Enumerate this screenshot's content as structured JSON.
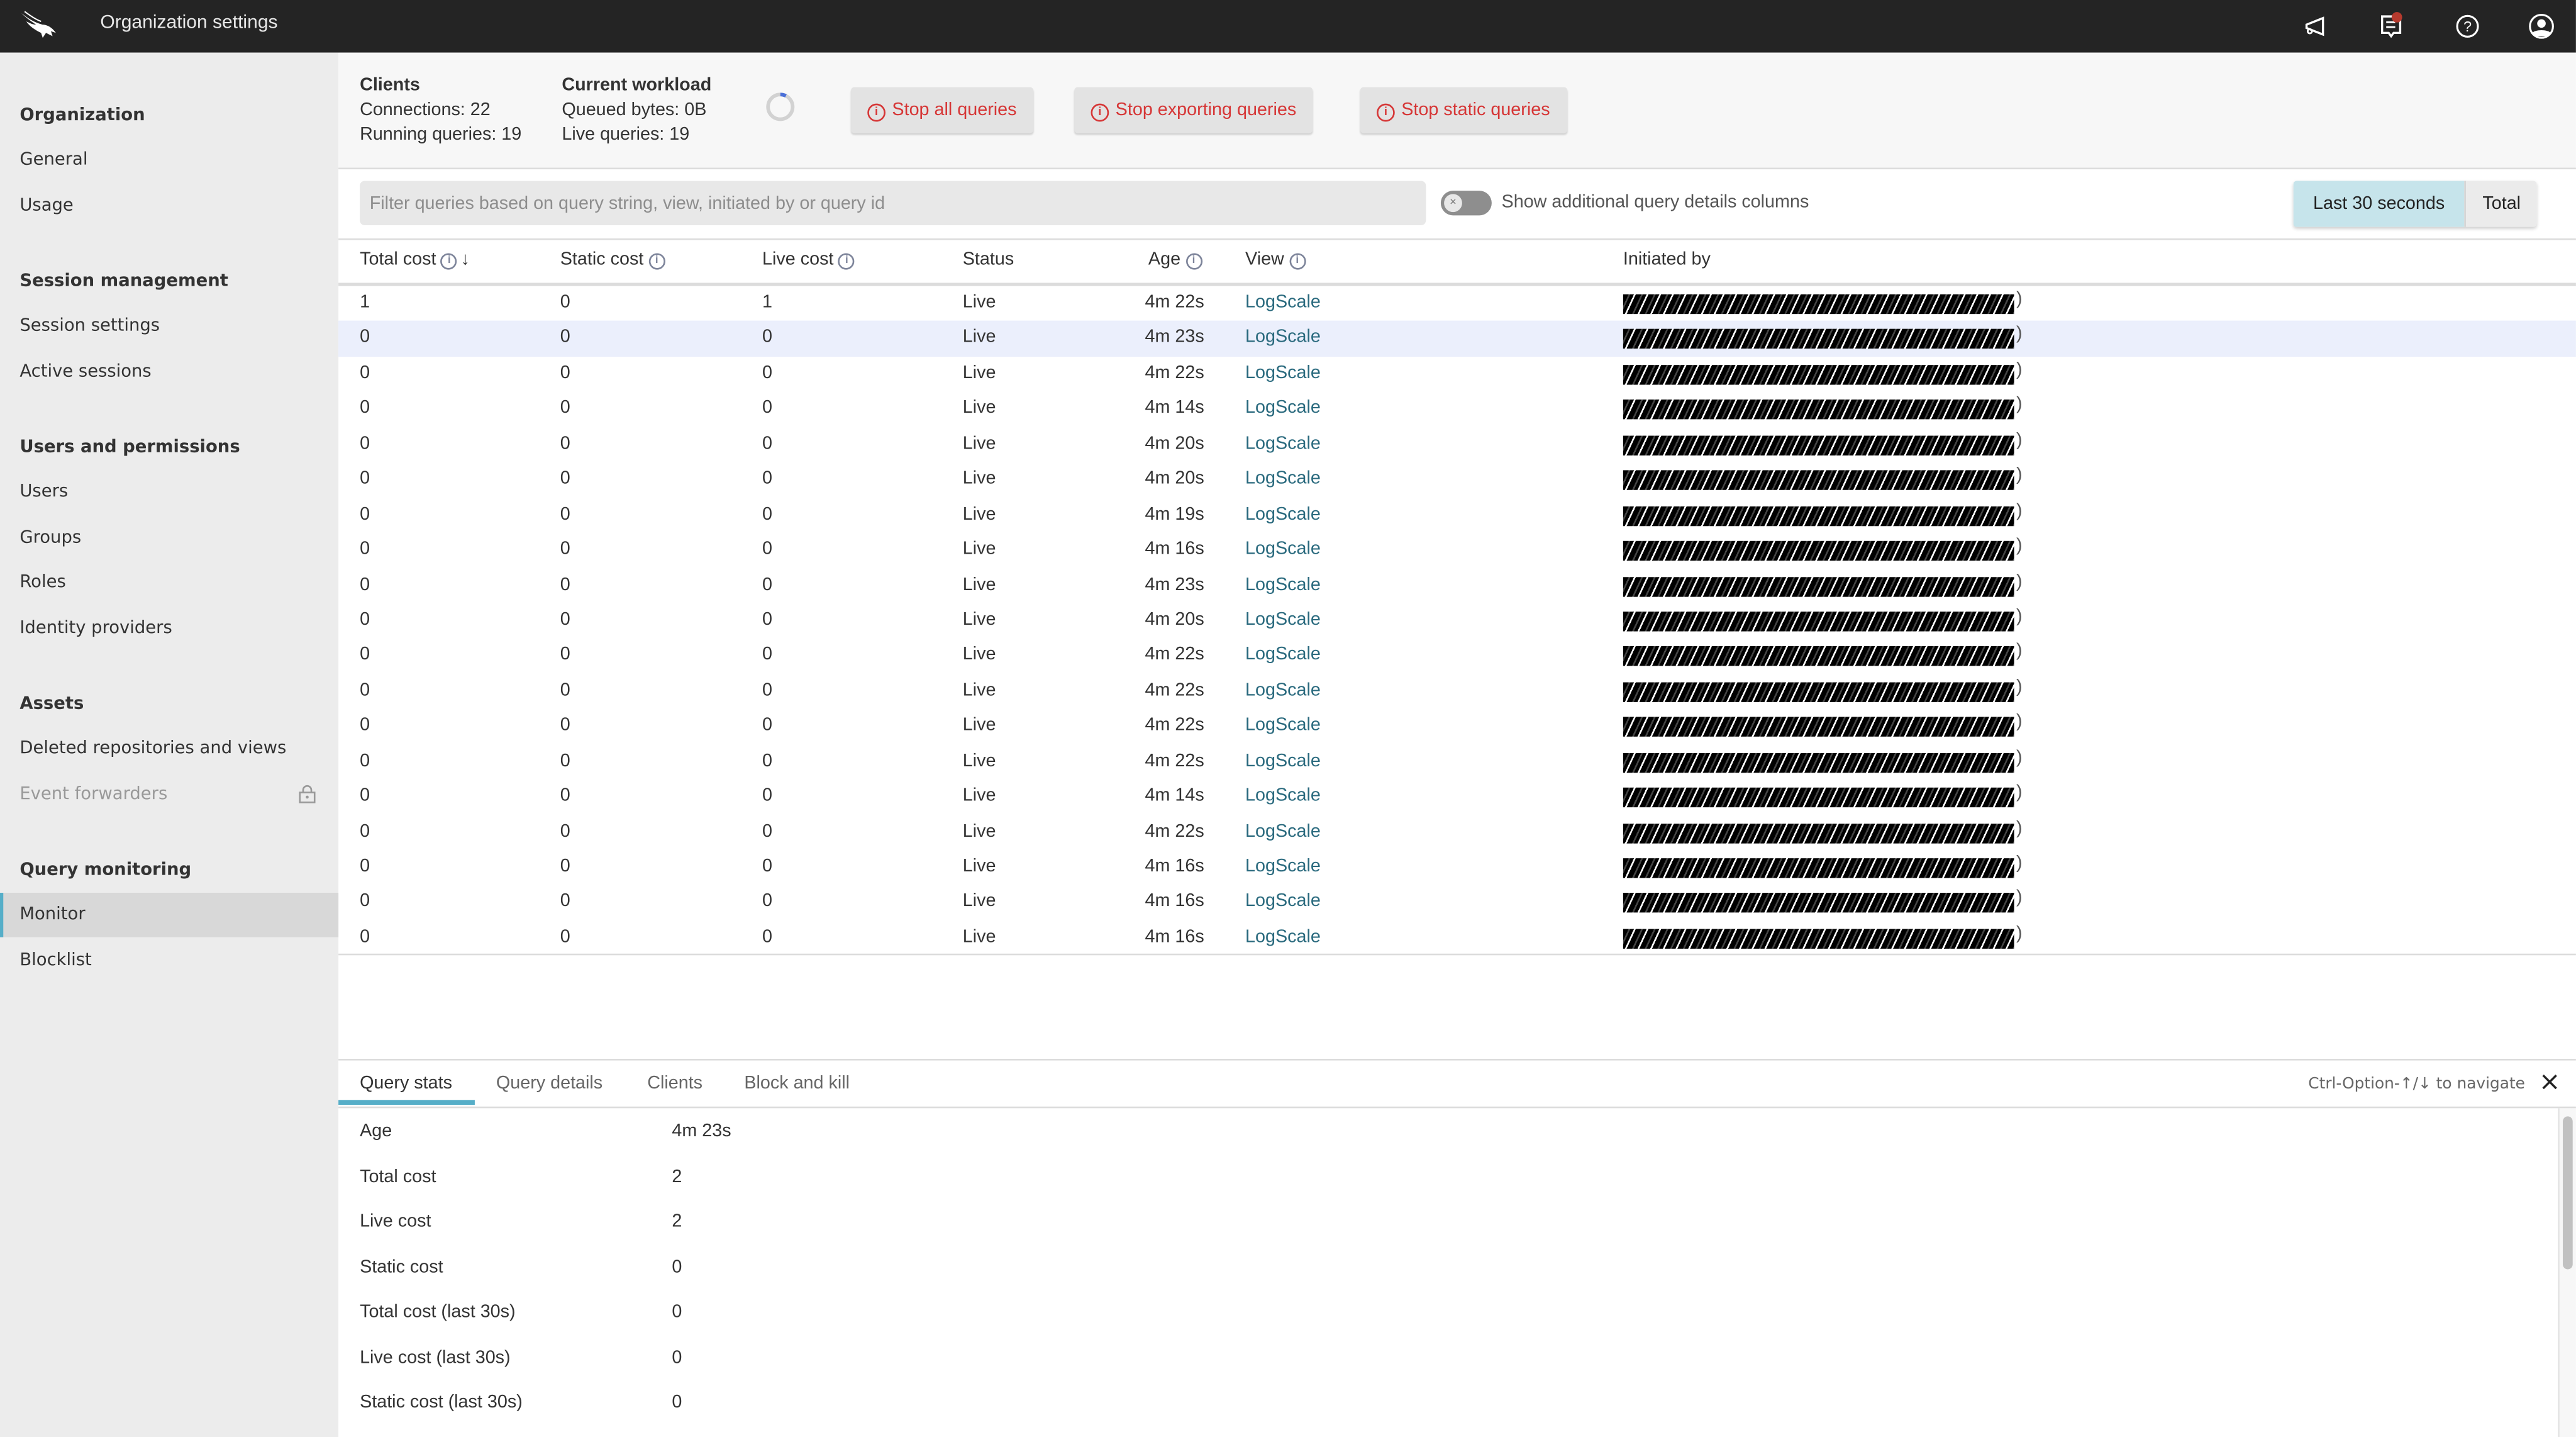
{
  "topbar": {
    "title": "Organization settings",
    "icons": [
      "announcements-icon",
      "notifications-icon",
      "help-icon",
      "user-account-icon"
    ],
    "notification_badge_color": "#b63a2e"
  },
  "sidebar": {
    "sections": [
      {
        "heading": "Organization",
        "items": [
          {
            "label": "General"
          },
          {
            "label": "Usage"
          }
        ]
      },
      {
        "heading": "Session management",
        "items": [
          {
            "label": "Session settings"
          },
          {
            "label": "Active sessions"
          }
        ]
      },
      {
        "heading": "Users and permissions",
        "items": [
          {
            "label": "Users"
          },
          {
            "label": "Groups"
          },
          {
            "label": "Roles"
          },
          {
            "label": "Identity providers"
          }
        ]
      },
      {
        "heading": "Assets",
        "items": [
          {
            "label": "Deleted repositories and views"
          },
          {
            "label": "Event forwarders",
            "disabled": true,
            "locked": true
          }
        ]
      },
      {
        "heading": "Query monitoring",
        "items": [
          {
            "label": "Monitor",
            "active": true
          },
          {
            "label": "Blocklist"
          }
        ]
      }
    ],
    "accent_color": "#56aec8"
  },
  "summary": {
    "clients_heading": "Clients",
    "connections": "Connections: 22",
    "running_queries": "Running queries: 19",
    "workload_heading": "Current workload",
    "queued_bytes": "Queued bytes: 0B",
    "live_queries": "Live queries: 19",
    "buttons": {
      "stop_all": "Stop all queries",
      "stop_exporting": "Stop exporting queries",
      "stop_static": "Stop static queries"
    },
    "danger_color": "#d63636"
  },
  "filter": {
    "placeholder": "Filter queries based on query string, view, initiated by or query id",
    "value": "",
    "toggle_label": "Show additional query details columns",
    "toggle_on": false,
    "time_options": [
      "Last 30 seconds",
      "Total"
    ],
    "selected_time_option": "Last 30 seconds"
  },
  "table": {
    "columns": [
      "Total cost",
      "Static cost",
      "Live cost",
      "Status",
      "Age",
      "View",
      "Initiated by"
    ],
    "sort_column": "Total cost",
    "sort_direction": "descending",
    "selected_row": 1,
    "rows": [
      {
        "total": "1",
        "static": "0",
        "live": "1",
        "status": "Live",
        "age": "4m 22s",
        "view": "LogScale",
        "initiated_by": "[redacted]"
      },
      {
        "total": "0",
        "static": "0",
        "live": "0",
        "status": "Live",
        "age": "4m 23s",
        "view": "LogScale",
        "initiated_by": "[redacted]"
      },
      {
        "total": "0",
        "static": "0",
        "live": "0",
        "status": "Live",
        "age": "4m 22s",
        "view": "LogScale",
        "initiated_by": "[redacted]"
      },
      {
        "total": "0",
        "static": "0",
        "live": "0",
        "status": "Live",
        "age": "4m 14s",
        "view": "LogScale",
        "initiated_by": "[redacted]"
      },
      {
        "total": "0",
        "static": "0",
        "live": "0",
        "status": "Live",
        "age": "4m 20s",
        "view": "LogScale",
        "initiated_by": "[redacted]"
      },
      {
        "total": "0",
        "static": "0",
        "live": "0",
        "status": "Live",
        "age": "4m 20s",
        "view": "LogScale",
        "initiated_by": "[redacted]"
      },
      {
        "total": "0",
        "static": "0",
        "live": "0",
        "status": "Live",
        "age": "4m 19s",
        "view": "LogScale",
        "initiated_by": "[redacted]"
      },
      {
        "total": "0",
        "static": "0",
        "live": "0",
        "status": "Live",
        "age": "4m 16s",
        "view": "LogScale",
        "initiated_by": "[redacted]"
      },
      {
        "total": "0",
        "static": "0",
        "live": "0",
        "status": "Live",
        "age": "4m 23s",
        "view": "LogScale",
        "initiated_by": "[redacted]"
      },
      {
        "total": "0",
        "static": "0",
        "live": "0",
        "status": "Live",
        "age": "4m 20s",
        "view": "LogScale",
        "initiated_by": "[redacted]"
      },
      {
        "total": "0",
        "static": "0",
        "live": "0",
        "status": "Live",
        "age": "4m 22s",
        "view": "LogScale",
        "initiated_by": "[redacted]"
      },
      {
        "total": "0",
        "static": "0",
        "live": "0",
        "status": "Live",
        "age": "4m 22s",
        "view": "LogScale",
        "initiated_by": "[redacted]"
      },
      {
        "total": "0",
        "static": "0",
        "live": "0",
        "status": "Live",
        "age": "4m 22s",
        "view": "LogScale",
        "initiated_by": "[redacted]"
      },
      {
        "total": "0",
        "static": "0",
        "live": "0",
        "status": "Live",
        "age": "4m 22s",
        "view": "LogScale",
        "initiated_by": "[redacted]"
      },
      {
        "total": "0",
        "static": "0",
        "live": "0",
        "status": "Live",
        "age": "4m 14s",
        "view": "LogScale",
        "initiated_by": "[redacted]"
      },
      {
        "total": "0",
        "static": "0",
        "live": "0",
        "status": "Live",
        "age": "4m 22s",
        "view": "LogScale",
        "initiated_by": "[redacted]"
      },
      {
        "total": "0",
        "static": "0",
        "live": "0",
        "status": "Live",
        "age": "4m 16s",
        "view": "LogScale",
        "initiated_by": "[redacted]"
      },
      {
        "total": "0",
        "static": "0",
        "live": "0",
        "status": "Live",
        "age": "4m 16s",
        "view": "LogScale",
        "initiated_by": "[redacted]"
      },
      {
        "total": "0",
        "static": "0",
        "live": "0",
        "status": "Live",
        "age": "4m 16s",
        "view": "LogScale",
        "initiated_by": "[redacted]"
      }
    ],
    "link_color": "#2a6a7e",
    "selected_row_color": "#ebeffc"
  },
  "details": {
    "tabs": [
      "Query stats",
      "Query details",
      "Clients",
      "Block and kill"
    ],
    "active_tab": "Query stats",
    "nav_hint": "Ctrl-Option-↑/↓ to navigate",
    "stats": [
      {
        "label": "Age",
        "value": "4m 23s"
      },
      {
        "label": "Total cost",
        "value": "2"
      },
      {
        "label": "Live cost",
        "value": "2"
      },
      {
        "label": "Static cost",
        "value": "0"
      },
      {
        "label": "Total cost (last 30s)",
        "value": "0"
      },
      {
        "label": "Live cost (last 30s)",
        "value": "0"
      },
      {
        "label": "Static cost (last 30s)",
        "value": "0"
      }
    ]
  }
}
